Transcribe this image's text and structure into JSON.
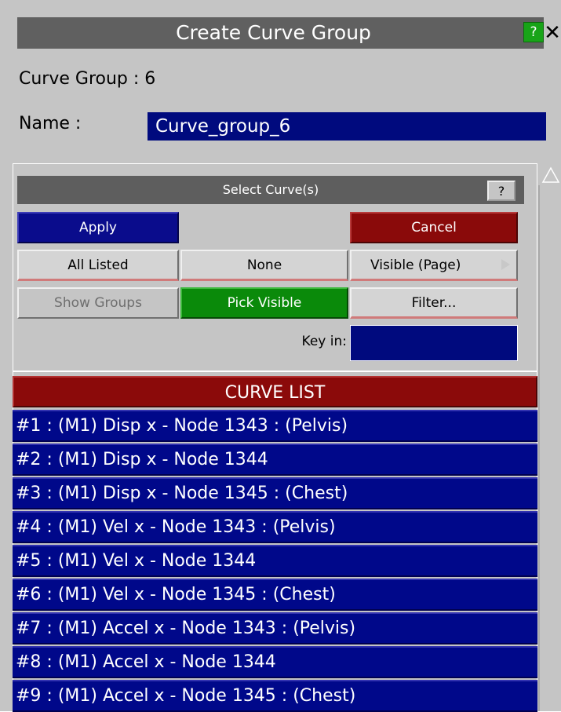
{
  "window": {
    "title": "Create Curve Group",
    "help_label": "?",
    "close_label": "✕"
  },
  "form": {
    "curve_group_label": "Curve Group : 6",
    "name_label": "Name :",
    "name_value": "Curve_group_6"
  },
  "selector": {
    "title": "Select Curve(s)",
    "help_label": "?",
    "apply_label": "Apply",
    "cancel_label": "Cancel",
    "all_listed_label": "All Listed",
    "none_label": "None",
    "visible_page_label": "Visible (Page)",
    "show_groups_label": "Show Groups",
    "pick_visible_label": "Pick Visible",
    "filter_label": "Filter...",
    "keyin_label": "Key in:",
    "keyin_value": ""
  },
  "curve_list": {
    "header": "CURVE LIST",
    "items": [
      "#1 : (M1) Disp x - Node 1343 : (Pelvis)",
      "#2 : (M1) Disp x - Node 1344",
      "#3 : (M1) Disp x - Node 1345 : (Chest)",
      "#4 : (M1) Vel x - Node 1343 : (Pelvis)",
      "#5 : (M1) Vel x - Node 1344",
      "#6 : (M1) Vel x - Node 1345 : (Chest)",
      "#7 : (M1) Accel x - Node 1343 : (Pelvis)",
      "#8 : (M1) Accel x - Node 1344",
      "#9 : (M1) Accel x - Node 1345 : (Chest)"
    ]
  },
  "colors": {
    "panel_bg": "#c5c5c5",
    "title_bg": "#606060",
    "field_blue": "#000a7e",
    "apply_blue": "#0a0c8c",
    "cancel_red": "#8a0a0a",
    "pick_green": "#0a8a0a",
    "list_item_blue": "#00088a",
    "list_header_red": "#8b0a0a"
  }
}
